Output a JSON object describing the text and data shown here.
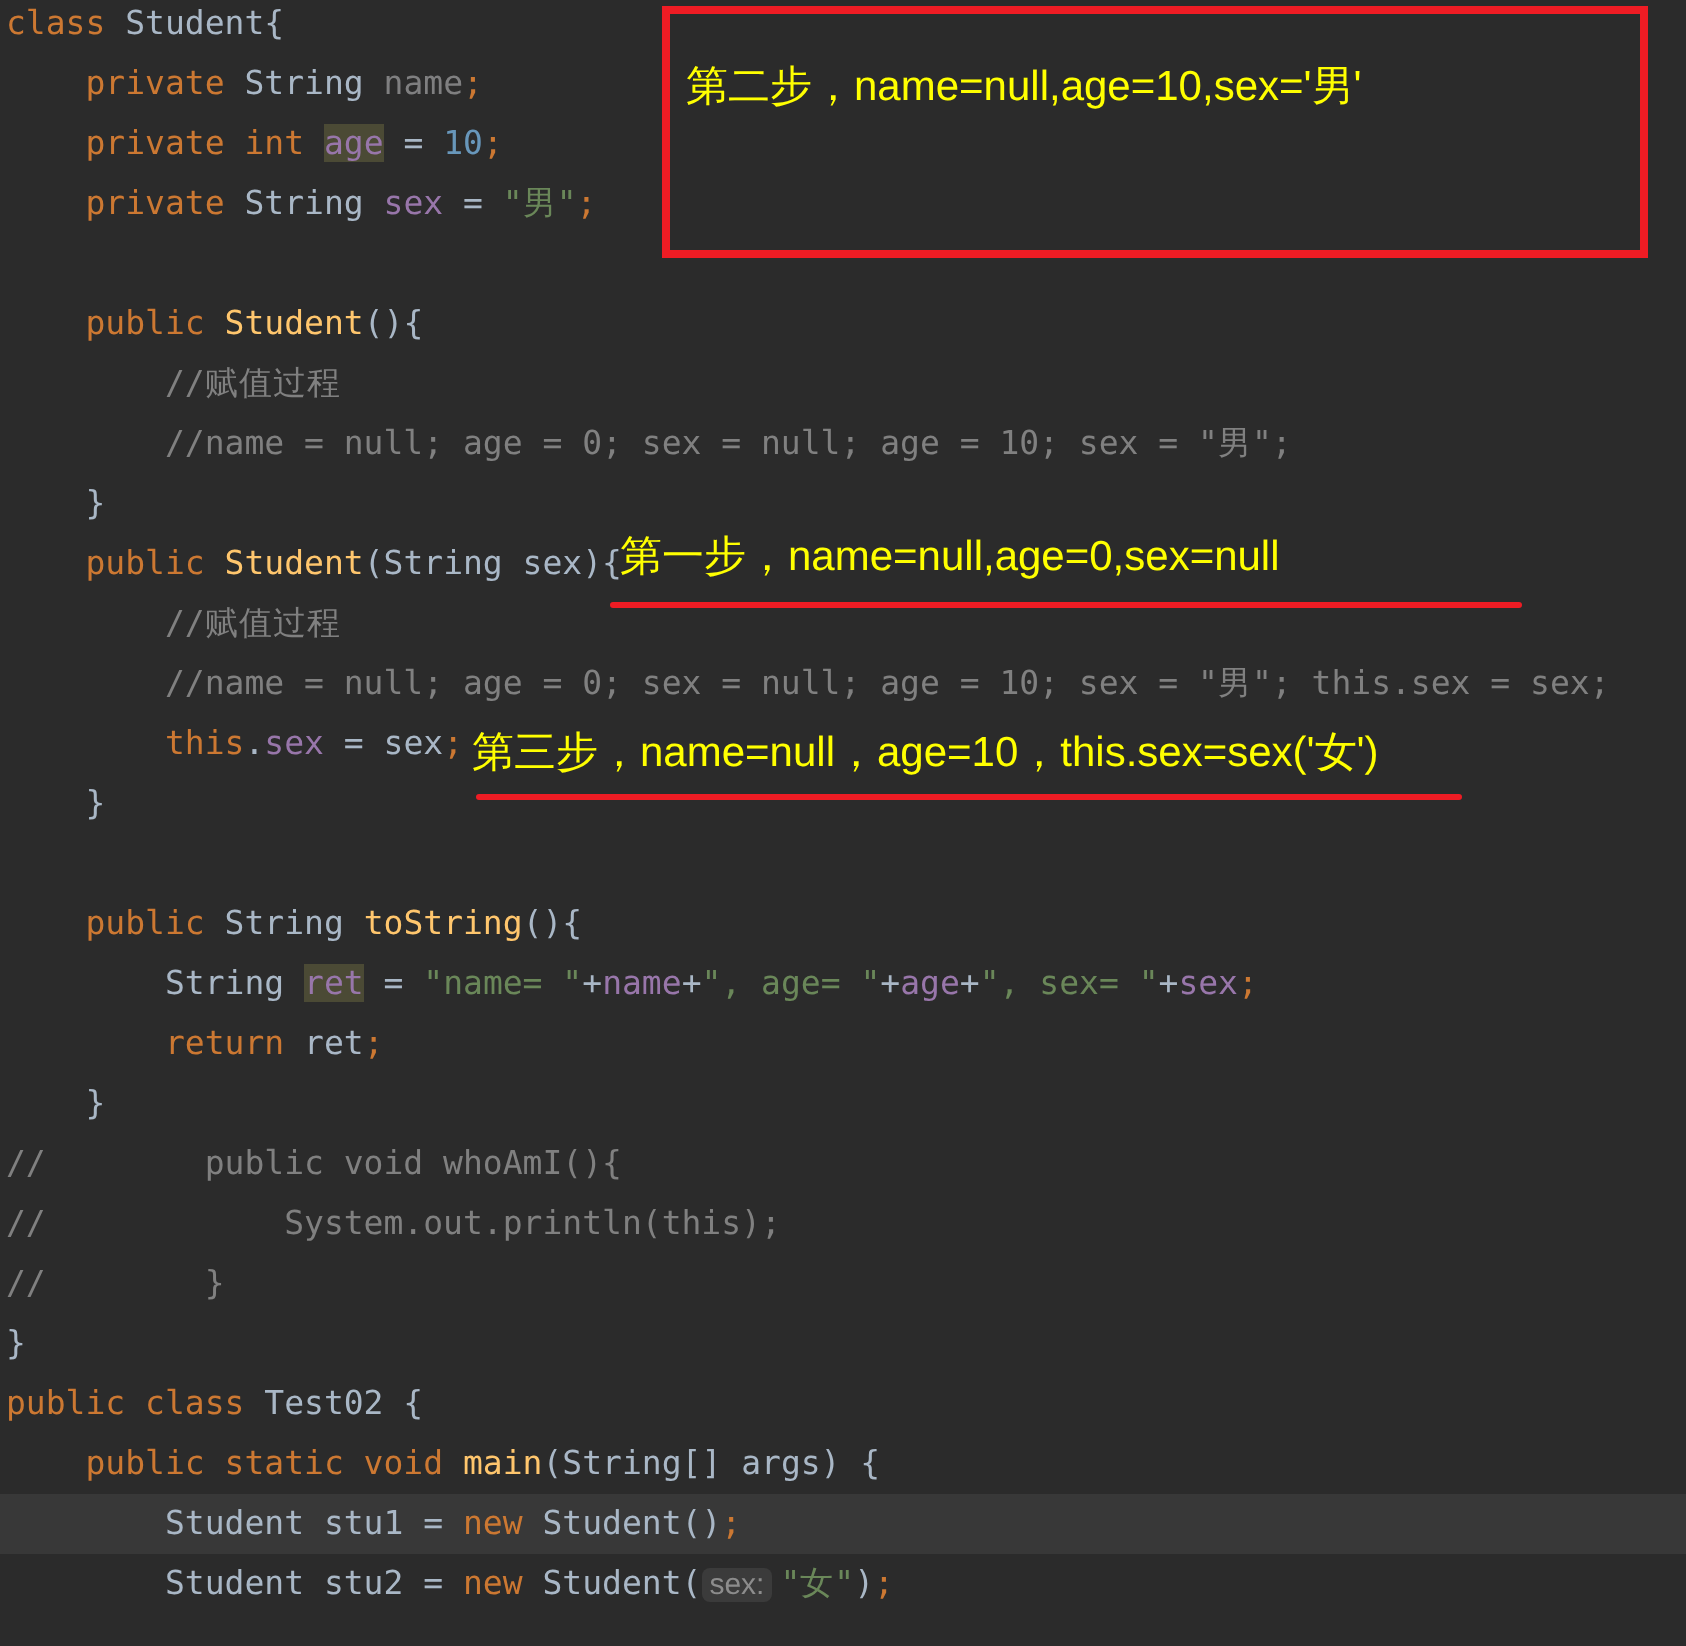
{
  "code_lines": [
    {
      "current": false,
      "tokens": [
        {
          "kind": "kw",
          "text": "class"
        },
        {
          "kind": "plain",
          "text": " Student{"
        }
      ]
    },
    {
      "current": false,
      "tokens": [
        {
          "kind": "kw",
          "text": "    private "
        },
        {
          "kind": "plain",
          "text": "String "
        },
        {
          "kind": "unused",
          "text": "name"
        },
        {
          "kind": "kw",
          "text": ";"
        }
      ]
    },
    {
      "current": false,
      "tokens": [
        {
          "kind": "kw",
          "text": "    private int "
        },
        {
          "kind": "hl",
          "text": "age"
        },
        {
          "kind": "plain",
          "text": " = "
        },
        {
          "kind": "num",
          "text": "10"
        },
        {
          "kind": "kw",
          "text": ";"
        }
      ]
    },
    {
      "current": false,
      "tokens": [
        {
          "kind": "kw",
          "text": "    private "
        },
        {
          "kind": "plain",
          "text": "String "
        },
        {
          "kind": "field",
          "text": "sex"
        },
        {
          "kind": "plain",
          "text": " = "
        },
        {
          "kind": "str",
          "text": "\"男\""
        },
        {
          "kind": "kw",
          "text": ";"
        }
      ]
    },
    {
      "current": false
    },
    {
      "current": false,
      "tokens": [
        {
          "kind": "kw",
          "text": "    public "
        },
        {
          "kind": "fn",
          "text": "Student"
        },
        {
          "kind": "plain",
          "text": "(){"
        }
      ]
    },
    {
      "current": false,
      "tokens": [
        {
          "kind": "cmt",
          "text": "        //赋值过程"
        }
      ]
    },
    {
      "current": false,
      "tokens": [
        {
          "kind": "cmt",
          "text": "        //name = null; age = 0; sex = null; age = 10; sex = \"男\";"
        }
      ]
    },
    {
      "current": false,
      "tokens": [
        {
          "kind": "plain",
          "text": "    }"
        }
      ]
    },
    {
      "current": false,
      "tokens": [
        {
          "kind": "kw",
          "text": "    public "
        },
        {
          "kind": "fn",
          "text": "Student"
        },
        {
          "kind": "plain",
          "text": "(String sex){"
        }
      ]
    },
    {
      "current": false,
      "tokens": [
        {
          "kind": "cmt",
          "text": "        //赋值过程"
        }
      ]
    },
    {
      "current": false,
      "tokens": [
        {
          "kind": "cmt",
          "text": "        //name = null; age = 0; sex = null; age = 10; sex = \"男\"; this.sex = sex;"
        }
      ]
    },
    {
      "current": false,
      "tokens": [
        {
          "kind": "kw",
          "text": "        this"
        },
        {
          "kind": "plain",
          "text": "."
        },
        {
          "kind": "field",
          "text": "sex"
        },
        {
          "kind": "plain",
          "text": " = sex"
        },
        {
          "kind": "kw",
          "text": ";"
        }
      ]
    },
    {
      "current": false,
      "tokens": [
        {
          "kind": "plain",
          "text": "    }"
        }
      ]
    },
    {
      "current": false
    },
    {
      "current": false,
      "tokens": [
        {
          "kind": "kw",
          "text": "    public "
        },
        {
          "kind": "plain",
          "text": "String "
        },
        {
          "kind": "fn",
          "text": "toString"
        },
        {
          "kind": "plain",
          "text": "(){"
        }
      ]
    },
    {
      "current": false,
      "tokens": [
        {
          "kind": "plain",
          "text": "        String "
        },
        {
          "kind": "hl",
          "text": "ret"
        },
        {
          "kind": "plain",
          "text": " = "
        },
        {
          "kind": "str",
          "text": "\"name= \""
        },
        {
          "kind": "plain",
          "text": "+"
        },
        {
          "kind": "field",
          "text": "name"
        },
        {
          "kind": "plain",
          "text": "+"
        },
        {
          "kind": "str",
          "text": "\", age= \""
        },
        {
          "kind": "plain",
          "text": "+"
        },
        {
          "kind": "field",
          "text": "age"
        },
        {
          "kind": "plain",
          "text": "+"
        },
        {
          "kind": "str",
          "text": "\", sex= \""
        },
        {
          "kind": "plain",
          "text": "+"
        },
        {
          "kind": "field",
          "text": "sex"
        },
        {
          "kind": "kw",
          "text": ";"
        }
      ]
    },
    {
      "current": false,
      "tokens": [
        {
          "kind": "kw",
          "text": "        return "
        },
        {
          "kind": "plain",
          "text": "ret"
        },
        {
          "kind": "kw",
          "text": ";"
        }
      ]
    },
    {
      "current": false,
      "tokens": [
        {
          "kind": "plain",
          "text": "    }"
        }
      ]
    },
    {
      "current": false,
      "tokens": [
        {
          "kind": "cmt",
          "text": "//        public void whoAmI(){"
        }
      ]
    },
    {
      "current": false,
      "tokens": [
        {
          "kind": "cmt",
          "text": "//            System.out.println(this);"
        }
      ]
    },
    {
      "current": false,
      "tokens": [
        {
          "kind": "cmt",
          "text": "//        }"
        }
      ]
    },
    {
      "current": false,
      "tokens": [
        {
          "kind": "plain",
          "text": "}"
        }
      ]
    },
    {
      "current": false,
      "tokens": [
        {
          "kind": "kw",
          "text": "public class "
        },
        {
          "kind": "plain",
          "text": "Test02 {"
        }
      ]
    },
    {
      "current": false,
      "tokens": [
        {
          "kind": "kw",
          "text": "    public static void "
        },
        {
          "kind": "fn",
          "text": "main"
        },
        {
          "kind": "plain",
          "text": "(String[] args) {"
        }
      ]
    },
    {
      "current": true,
      "tokens": [
        {
          "kind": "plain",
          "text": "        Student stu1 = "
        },
        {
          "kind": "kw",
          "text": "new "
        },
        {
          "kind": "plain",
          "text": "Student()"
        },
        {
          "kind": "kw",
          "text": ";"
        }
      ]
    },
    {
      "current": false,
      "tokens": [
        {
          "kind": "plain",
          "text": "        Student stu2 = "
        },
        {
          "kind": "kw",
          "text": "new "
        },
        {
          "kind": "plain",
          "text": "Student("
        },
        {
          "kind": "hint",
          "text": "sex:"
        },
        {
          "kind": "str",
          "text": "\"女\""
        },
        {
          "kind": "plain",
          "text": ")"
        },
        {
          "kind": "kw",
          "text": ";"
        }
      ]
    }
  ],
  "annotations": [
    {
      "kind": "boxed",
      "text": "第二步，name=null,age=10,sex='男'"
    },
    {
      "kind": "underlined",
      "text": "第一步，name=null,age=0,sex=null"
    },
    {
      "kind": "underlined",
      "text": "第三步，name=null，age=10，this.sex=sex('女')"
    }
  ]
}
